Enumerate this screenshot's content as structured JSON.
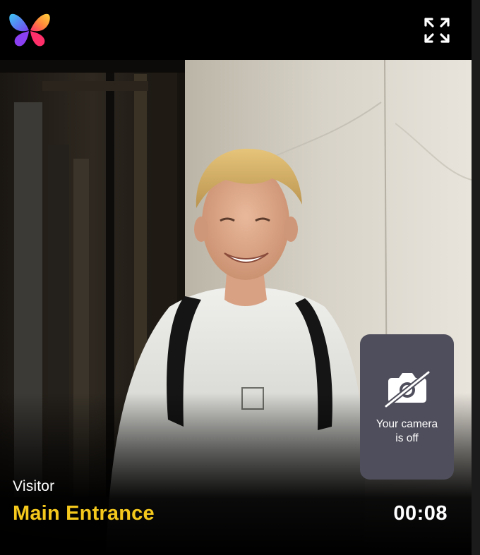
{
  "app": {
    "logo_icon": "butterfly-logo-icon",
    "expand_icon": "fullscreen-expand-icon"
  },
  "call": {
    "caller_role": "Visitor",
    "location_name": "Main Entrance",
    "duration": "00:08"
  },
  "self_view": {
    "status_icon": "camera-off-icon",
    "status_text": "Your camera\nis off"
  },
  "colors": {
    "location_accent": "#f4c81c",
    "background": "#000000",
    "self_view_tile": "#4f4e5c",
    "text": "#ffffff"
  }
}
